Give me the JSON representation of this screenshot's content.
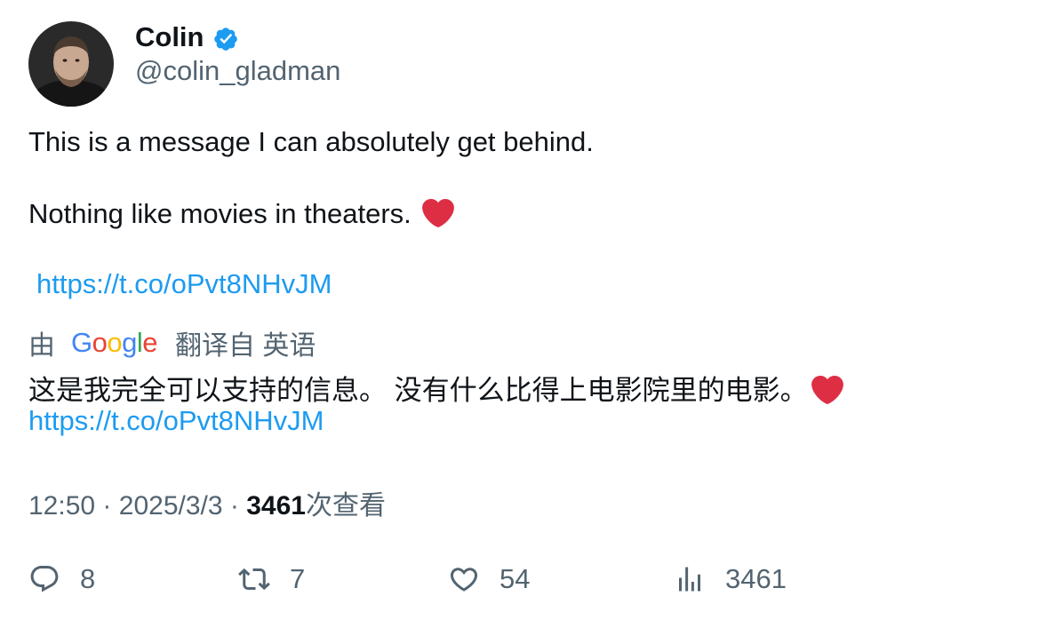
{
  "author": {
    "display_name": "Colin",
    "handle": "@colin_gladman",
    "verified_icon": "verified-badge-icon",
    "avatar": "avatar"
  },
  "tweet": {
    "line1": "This is a message I can absolutely get behind.",
    "line2": "Nothing like movies in theaters.",
    "link": "https://t.co/oPvt8NHvJM",
    "heart_emoji": "heart-emoji"
  },
  "translation": {
    "prefix": "由",
    "provider": "Google",
    "suffix": "翻译自 英语",
    "text": "这是我完全可以支持的信息。 没有什么比得上电影院里的电影。",
    "link": "https://t.co/oPvt8NHvJM"
  },
  "meta": {
    "time": "12:50",
    "date": "2025/3/3",
    "views_count": "3461",
    "views_label": "次查看",
    "separator": "·"
  },
  "actions": {
    "replies": "8",
    "retweets": "7",
    "likes": "54",
    "views": "3461"
  },
  "colors": {
    "text": "#0f1419",
    "secondary": "#536471",
    "link": "#1d9bf0",
    "verified": "#1d9bf0",
    "heart": "#dd2e44"
  }
}
